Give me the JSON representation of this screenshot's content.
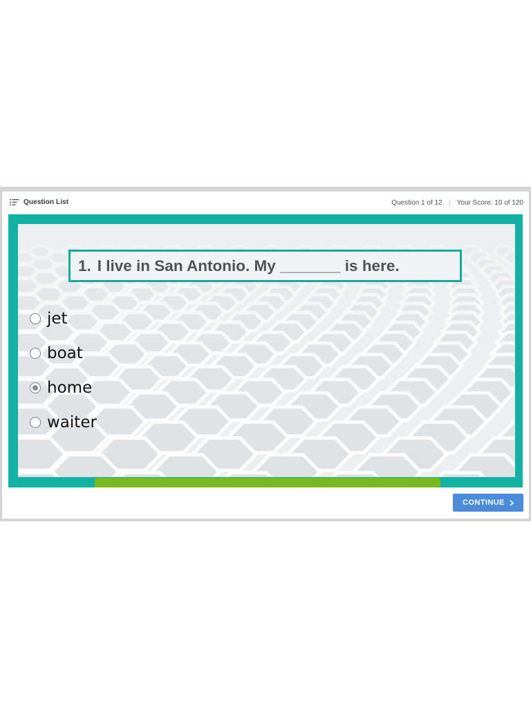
{
  "topbar": {
    "question_list_label": "Question List",
    "question_counter": "Question 1 of 12",
    "score": "Your Score: 10 of 120",
    "icons": {
      "question_list": "list-icon"
    }
  },
  "question": {
    "number": "1.",
    "text": "I live in San Antonio. My _______ is here."
  },
  "choices": [
    {
      "label": "jet",
      "selected": false
    },
    {
      "label": "boat",
      "selected": false
    },
    {
      "label": "home",
      "selected": true
    },
    {
      "label": "waiter",
      "selected": false
    }
  ],
  "progress": {
    "fraction": 1.0
  },
  "footer": {
    "continue_label": "CONTINUE",
    "continue_icon": "chevron-right-icon"
  },
  "colors": {
    "frame_teal": "#12b1a3",
    "progress_green": "#7ab91e",
    "button_blue": "#4b8bdc"
  }
}
